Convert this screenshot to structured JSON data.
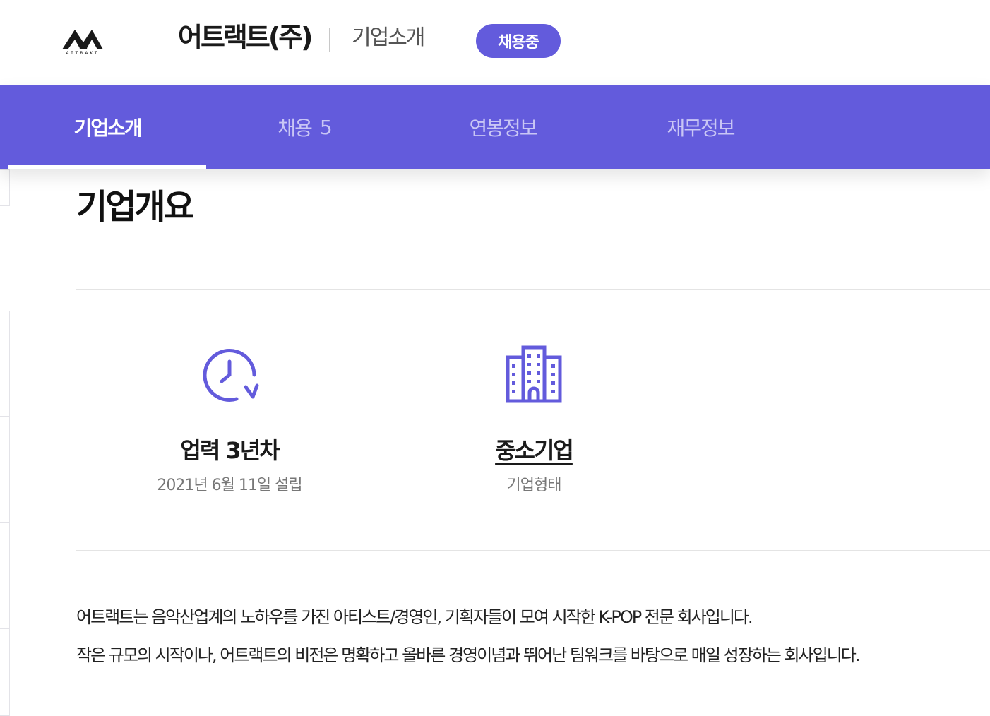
{
  "header": {
    "logo_text": "ATTRAKT",
    "company_name": "어트랙트(주)",
    "subtitle": "기업소개",
    "badge": "채용중"
  },
  "nav": {
    "tabs": [
      {
        "label": "기업소개",
        "count": "",
        "active": true
      },
      {
        "label": "채용",
        "count": "5",
        "active": false
      },
      {
        "label": "연봉정보",
        "count": "",
        "active": false
      },
      {
        "label": "재무정보",
        "count": "",
        "active": false
      }
    ]
  },
  "overview": {
    "title": "기업개요",
    "stats": [
      {
        "icon": "history-clock-icon",
        "value": "업력 3년차",
        "label": "2021년 6월 11일 설립"
      },
      {
        "icon": "building-icon",
        "value": "중소기업",
        "label": "기업형태"
      }
    ],
    "description": [
      "어트랙트는 음악산업계의 노하우를 가진 아티스트/경영인, 기획자들이 모여 시작한 K-POP 전문 회사입니다.",
      "작은 규모의 시작이나, 어트랙트의 비전은 명확하고 올바른 경영이념과 뛰어난 팀워크를 바탕으로 매일 성장하는 회사입니다."
    ]
  },
  "colors": {
    "accent": "#635bdc",
    "inactive_tab": "#c9c6f5",
    "text": "#222222",
    "muted": "#777777"
  }
}
